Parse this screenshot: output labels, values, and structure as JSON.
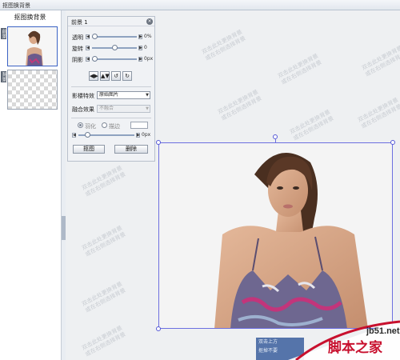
{
  "window": {
    "title": "抠图换背景"
  },
  "left_panel": {
    "title": "抠图换背景",
    "layers": [
      {
        "tag": "前景"
      },
      {
        "tag": "背景"
      }
    ]
  },
  "tool_panel": {
    "title": "前景 1",
    "close_icon": "close-icon",
    "sliders": [
      {
        "label": "透明",
        "value_text": "0%",
        "level": 0.05
      },
      {
        "label": "旋转",
        "value_text": "0",
        "level": 0.5
      },
      {
        "label": "阴影",
        "value_text": "0px",
        "level": 0.05
      }
    ],
    "tool_icons": [
      "flip-horizontal-icon",
      "flip-vertical-icon",
      "rotate-left-icon",
      "rotate-right-icon"
    ],
    "tool_glyphs": [
      "◀▶",
      "▲▼",
      "↺",
      "↻"
    ],
    "image_effect": {
      "label": "影楼特效",
      "value": "原始图片"
    },
    "blend": {
      "label": "融合效果",
      "value": "不融合"
    },
    "radios": [
      {
        "label": "羽化",
        "selected": true
      },
      {
        "label": "描边",
        "selected": false
      }
    ],
    "feather": {
      "value_text": "0px",
      "level": 0.15
    },
    "buttons": {
      "cutout": "抠图",
      "delete": "删除"
    }
  },
  "canvas": {
    "watermark_lines": [
      "双击此处更换背景",
      "或在右侧选择背景"
    ]
  },
  "bottom_tip": {
    "lines": [
      "双击上方",
      "抠掉不要"
    ]
  },
  "site_logo": {
    "domain": "jb51.net",
    "name": "脚本之家"
  },
  "colors": {
    "selection": "#6c6fe0",
    "logo_red": "#c8102e",
    "tip_bg": "#3b5f9e"
  }
}
